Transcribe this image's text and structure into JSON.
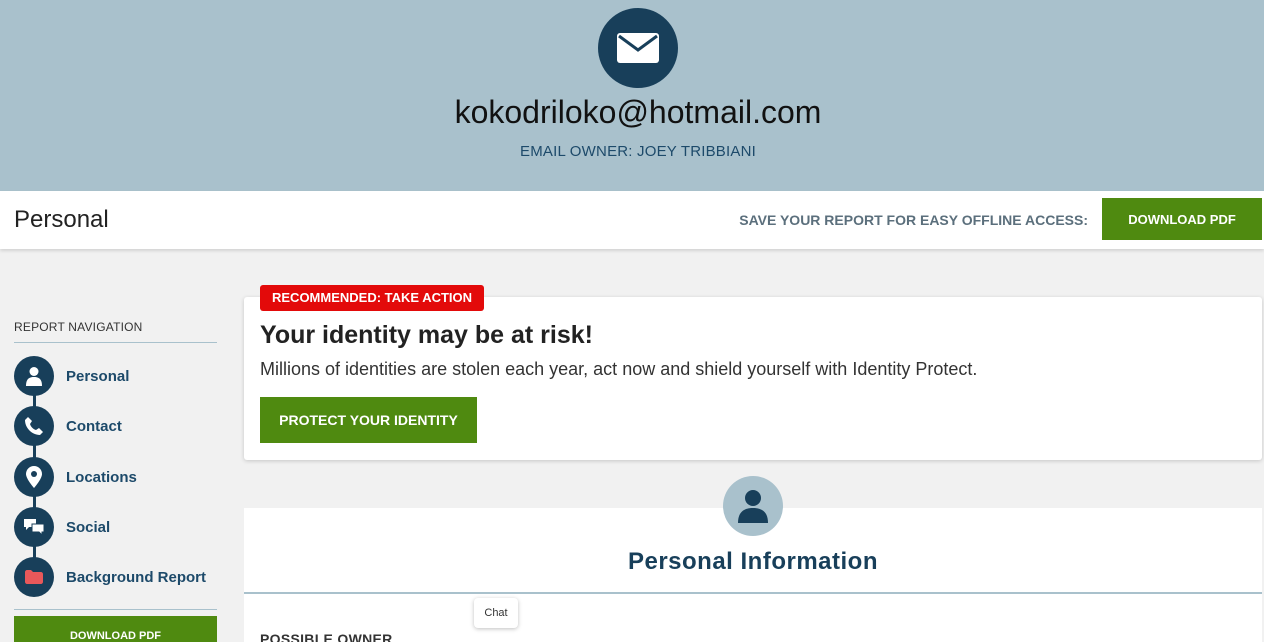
{
  "header": {
    "email": "kokodriloko@hotmail.com",
    "owner": "EMAIL OWNER: JOEY TRIBBIANI",
    "icon": "envelope-icon"
  },
  "section_bar": {
    "title": "Personal",
    "save_label": "SAVE YOUR REPORT FOR EASY OFFLINE ACCESS:",
    "download_label": "DOWNLOAD PDF"
  },
  "nav": {
    "heading": "REPORT NAVIGATION",
    "items": [
      {
        "label": "Personal",
        "icon": "person-icon"
      },
      {
        "label": "Contact",
        "icon": "phone-icon"
      },
      {
        "label": "Locations",
        "icon": "map-pin-icon"
      },
      {
        "label": "Social",
        "icon": "chat-bubbles-icon"
      },
      {
        "label": "Background Report",
        "icon": "folder-icon"
      }
    ],
    "download_label": "DOWNLOAD PDF"
  },
  "alert": {
    "tag": "RECOMMENDED: TAKE ACTION",
    "title": "Your identity may be at risk!",
    "body": "Millions of identities are stolen each year, act now and shield yourself with Identity Protect.",
    "button_label": "PROTECT YOUR IDENTITY"
  },
  "personal_info": {
    "title": "Personal Information",
    "subheading": "POSSIBLE OWNER",
    "icon": "person-icon"
  },
  "chat": {
    "label": "Chat"
  },
  "colors": {
    "navy": "#183f5a",
    "hero_bg": "#a9c1cc",
    "green": "#4f8a10",
    "alert_red": "#e30a0a"
  }
}
